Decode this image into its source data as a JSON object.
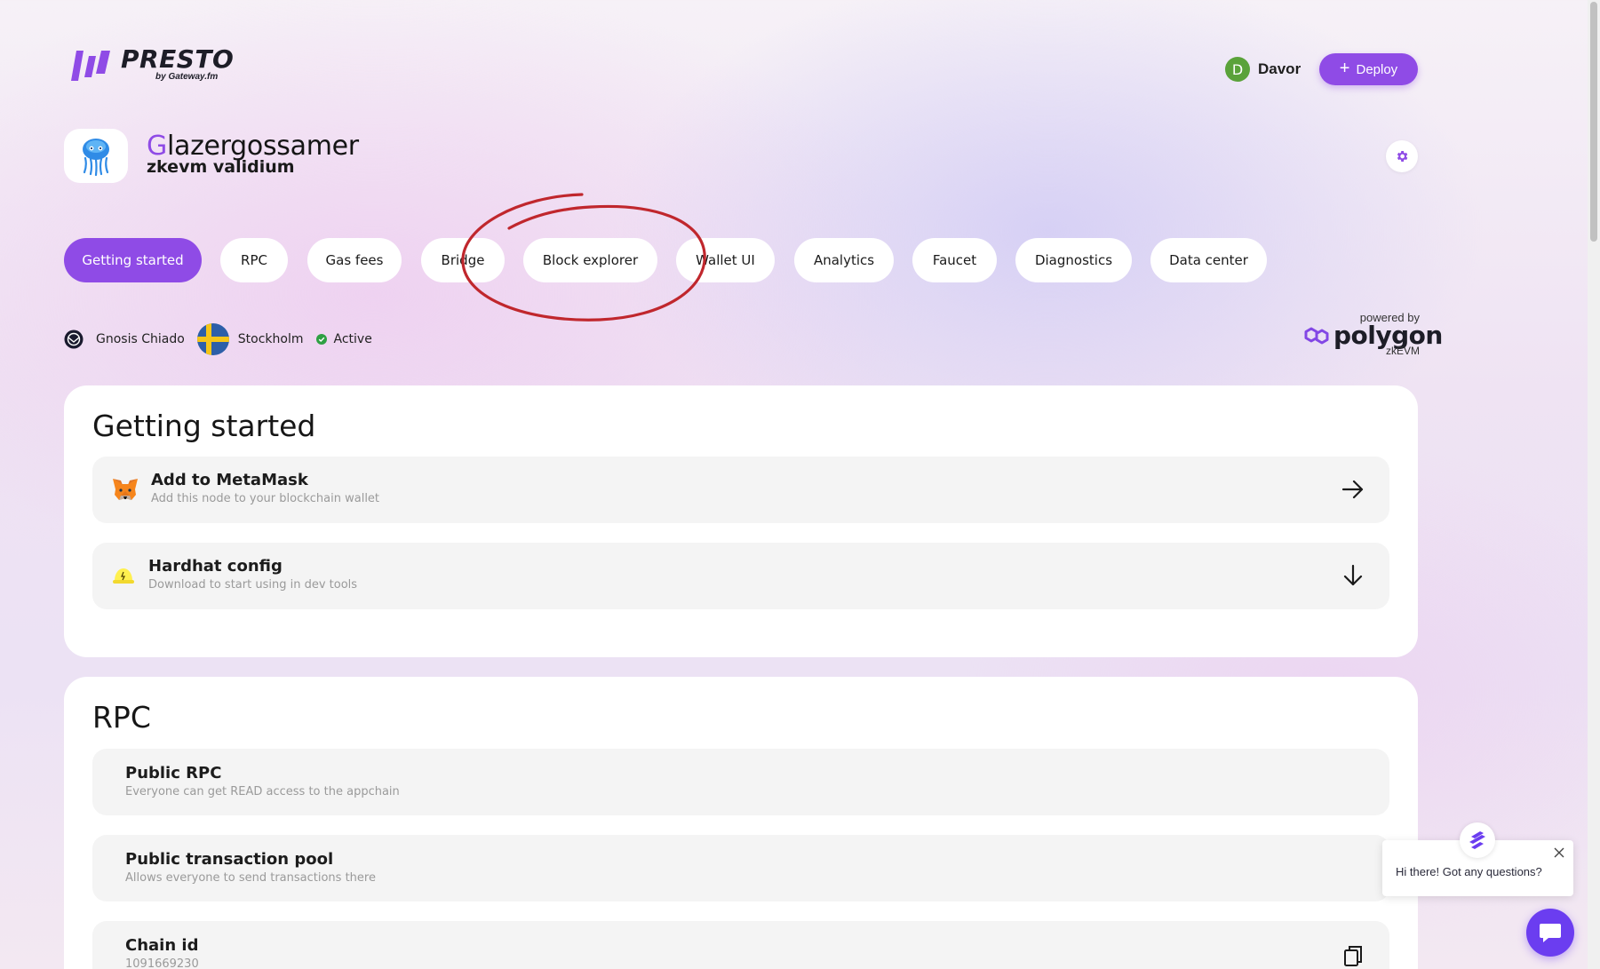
{
  "brand": {
    "name": "PRESTO",
    "byline": "by Gateway.fm"
  },
  "header": {
    "user_initial": "D",
    "user_name": "Davor",
    "deploy_label": "Deploy"
  },
  "chain": {
    "name_first": "G",
    "name_rest": "lazergossamer",
    "type": "zkevm validium"
  },
  "tabs": [
    {
      "label": "Getting started",
      "active": true
    },
    {
      "label": "RPC"
    },
    {
      "label": "Gas fees"
    },
    {
      "label": "Bridge"
    },
    {
      "label": "Block explorer"
    },
    {
      "label": "Wallet UI"
    },
    {
      "label": "Analytics"
    },
    {
      "label": "Faucet"
    },
    {
      "label": "Diagnostics"
    },
    {
      "label": "Data center"
    }
  ],
  "meta": {
    "network": "Gnosis Chiado",
    "location": "Stockholm",
    "status": "Active"
  },
  "powered": {
    "by": "powered by",
    "name": "polygon",
    "product": "zkEVM"
  },
  "getting_started": {
    "title": "Getting started",
    "items": [
      {
        "title": "Add to MetaMask",
        "subtitle": "Add this node to your blockchain wallet",
        "icon": "metamask-fox-icon",
        "action_icon": "arrow-right-icon"
      },
      {
        "title": "Hardhat config",
        "subtitle": "Download to start using in dev tools",
        "icon": "hardhat-icon",
        "action_icon": "arrow-down-icon"
      }
    ]
  },
  "rpc": {
    "title": "RPC",
    "items": [
      {
        "title": "Public RPC",
        "subtitle": "Everyone can get READ access to the appchain"
      },
      {
        "title": "Public transaction pool",
        "subtitle": "Allows everyone to send transactions there"
      },
      {
        "title": "Chain id",
        "subtitle": "1091669230",
        "action_icon": "copy-icon"
      }
    ]
  },
  "chat": {
    "greeting": "Hi there! Got any questions?"
  },
  "colors": {
    "accent": "#8f4be6",
    "status_active": "#2ea043",
    "annotation": "#c0272d"
  }
}
